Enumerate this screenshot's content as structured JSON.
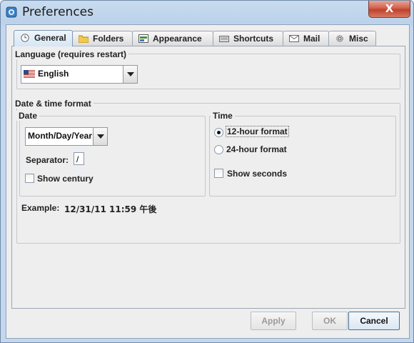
{
  "window": {
    "title": "Preferences",
    "close_label": "X"
  },
  "tabs": [
    {
      "label": "General",
      "icon": "clock-icon",
      "active": true
    },
    {
      "label": "Folders",
      "icon": "folder-icon",
      "active": false
    },
    {
      "label": "Appearance",
      "icon": "appearance-icon",
      "active": false
    },
    {
      "label": "Shortcuts",
      "icon": "keyboard-icon",
      "active": false
    },
    {
      "label": "Mail",
      "icon": "envelope-icon",
      "active": false
    },
    {
      "label": "Misc",
      "icon": "gear-icon",
      "active": false
    }
  ],
  "language": {
    "group_label": "Language (requires restart)",
    "selected": "English",
    "flag_icon": "us-flag-icon"
  },
  "datetime": {
    "group_label": "Date & time format",
    "date": {
      "group_label": "Date",
      "format_selected": "Month/Day/Year",
      "separator_label": "Separator:",
      "separator_value": "/",
      "show_century_label": "Show century",
      "show_century_checked": false
    },
    "time": {
      "group_label": "Time",
      "option_12": "12-hour format",
      "option_24": "24-hour format",
      "selected": "12-hour format",
      "show_seconds_label": "Show seconds",
      "show_seconds_checked": false
    },
    "example_label": "Example:",
    "example_value": "12/31/11 11:59 午後"
  },
  "buttons": {
    "apply": "Apply",
    "ok": "OK",
    "cancel": "Cancel"
  }
}
